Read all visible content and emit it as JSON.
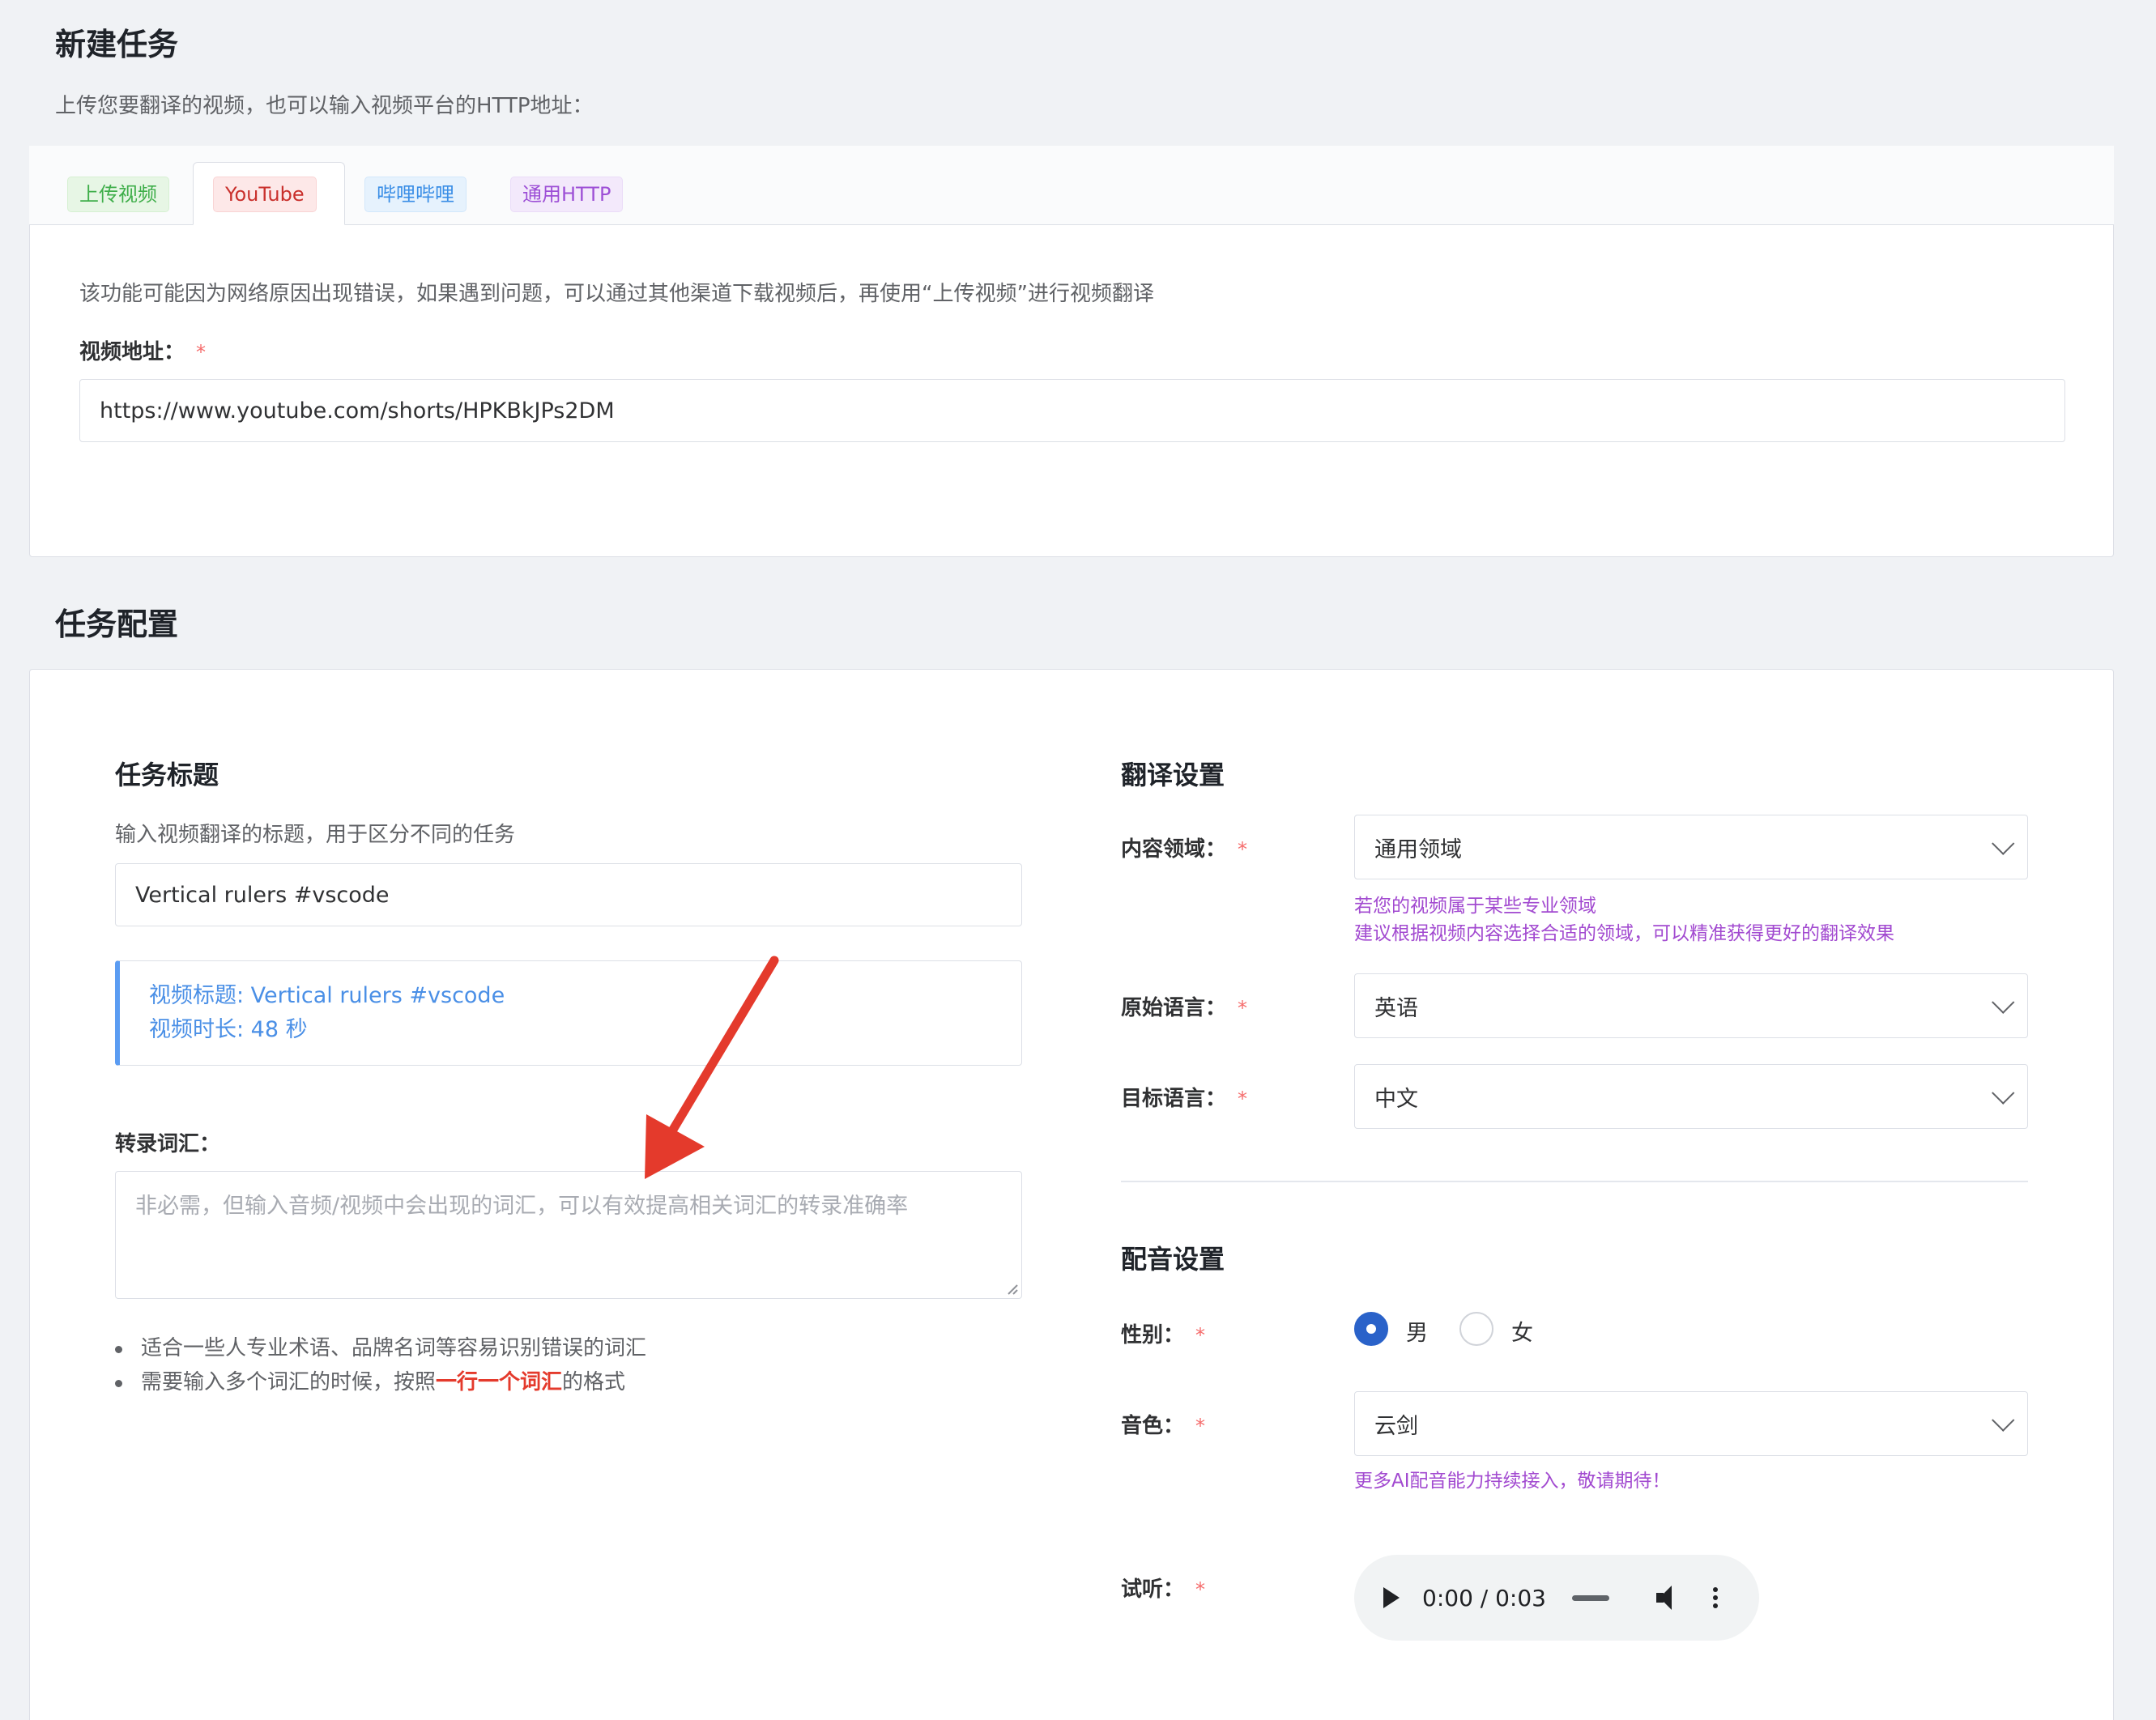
{
  "header": {
    "title": "新建任务",
    "subtitle": "上传您要翻译的视频，也可以输入视频平台的HTTP地址："
  },
  "tabs": [
    {
      "label": "上传视频",
      "color": "#3fae4a"
    },
    {
      "label": "YouTube",
      "color": "#c9302c",
      "active": true
    },
    {
      "label": "哔哩哔哩",
      "color": "#3a8ee6"
    },
    {
      "label": "通用HTTP",
      "color": "#9d4fd6"
    }
  ],
  "source": {
    "notice": "该功能可能因为网络原因出现错误，如果遇到问题，可以通过其他渠道下载视频后，再使用“上传视频”进行视频翻译",
    "url_label": "视频地址：",
    "required_mark": "*",
    "url_value": "https://www.youtube.com/shorts/HPKBkJPs2DM"
  },
  "config": {
    "title": "任务配置",
    "task_title": {
      "heading": "任务标题",
      "description": "输入视频翻译的标题，用于区分不同的任务",
      "value": "Vertical rulers #vscode"
    },
    "video_info": {
      "title_line": "视频标题: Vertical rulers #vscode",
      "duration_line": "视频时长: 48 秒"
    },
    "vocabulary": {
      "label": "转录词汇：",
      "placeholder": "非必需，但输入音频/视频中会出现的词汇，可以有效提高相关词汇的转录准确率",
      "tip1": "适合一些人专业术语、品牌名词等容易识别错误的词汇",
      "tip2_prefix": "需要输入多个词汇的时候，按照",
      "tip2_highlight": "一行一个词汇",
      "tip2_suffix": "的格式"
    },
    "translation": {
      "heading": "翻译设置",
      "domain_label": "内容领域：",
      "domain_value": "通用领域",
      "domain_hint1": "若您的视频属于某些专业领域",
      "domain_hint2": "建议根据视频内容选择合适的领域，可以精准获得更好的翻译效果",
      "source_lang_label": "原始语言：",
      "source_lang_value": "英语",
      "target_lang_label": "目标语言：",
      "target_lang_value": "中文"
    },
    "dubbing": {
      "heading": "配音设置",
      "gender_label": "性别：",
      "gender_male": "男",
      "gender_female": "女",
      "gender_selected": "男",
      "voice_label": "音色：",
      "voice_value": "云剑",
      "voice_hint": "更多AI配音能力持续接入，敬请期待！",
      "preview_label": "试听：",
      "audio_time": "0:00 / 0:03"
    }
  },
  "colors": {
    "background": "#f0f2f5",
    "required": "#f56c6c",
    "hint": "#a24ad0",
    "info": "#4a8fe6",
    "radio_selected": "#2a62c9",
    "arrow": "#e43a2c"
  }
}
